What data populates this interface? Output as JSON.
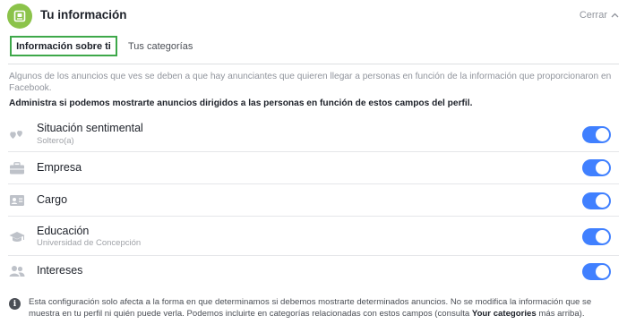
{
  "header": {
    "title": "Tu información",
    "close_label": "Cerrar"
  },
  "tabs": [
    {
      "label": "Información sobre ti",
      "active": true
    },
    {
      "label": "Tus categorías",
      "active": false
    }
  ],
  "intro": "Algunos de los anuncios que ves se deben a que hay anunciantes que quieren llegar a personas en función de la información que proporcionaron en Facebook.",
  "subheading": "Administra si podemos mostrarte anuncios dirigidos a las personas en función de estos campos del perfil.",
  "fields": [
    {
      "label": "Situación sentimental",
      "value": "Soltero(a)",
      "icon": "hearts-icon",
      "enabled": true
    },
    {
      "label": "Empresa",
      "value": "",
      "icon": "briefcase-icon",
      "enabled": true
    },
    {
      "label": "Cargo",
      "value": "",
      "icon": "id-card-icon",
      "enabled": true
    },
    {
      "label": "Educación",
      "value": "Universidad de Concepción",
      "icon": "graduation-cap-icon",
      "enabled": true
    },
    {
      "label": "Intereses",
      "value": "",
      "icon": "people-icon",
      "enabled": true
    }
  ],
  "footer": {
    "text_before": "Esta configuración solo afecta a la forma en que determinamos si debemos mostrarte determinados anuncios. No se modifica la información que se muestra en tu perfil ni quién puede verla. Podemos incluirte en categorías relacionadas con estos campos (consulta ",
    "link": "Your categories",
    "text_after": " más arriba)."
  },
  "colors": {
    "accent_green": "#8bc34a",
    "tab_border": "#3ea84a",
    "toggle_on": "#4080ff"
  }
}
